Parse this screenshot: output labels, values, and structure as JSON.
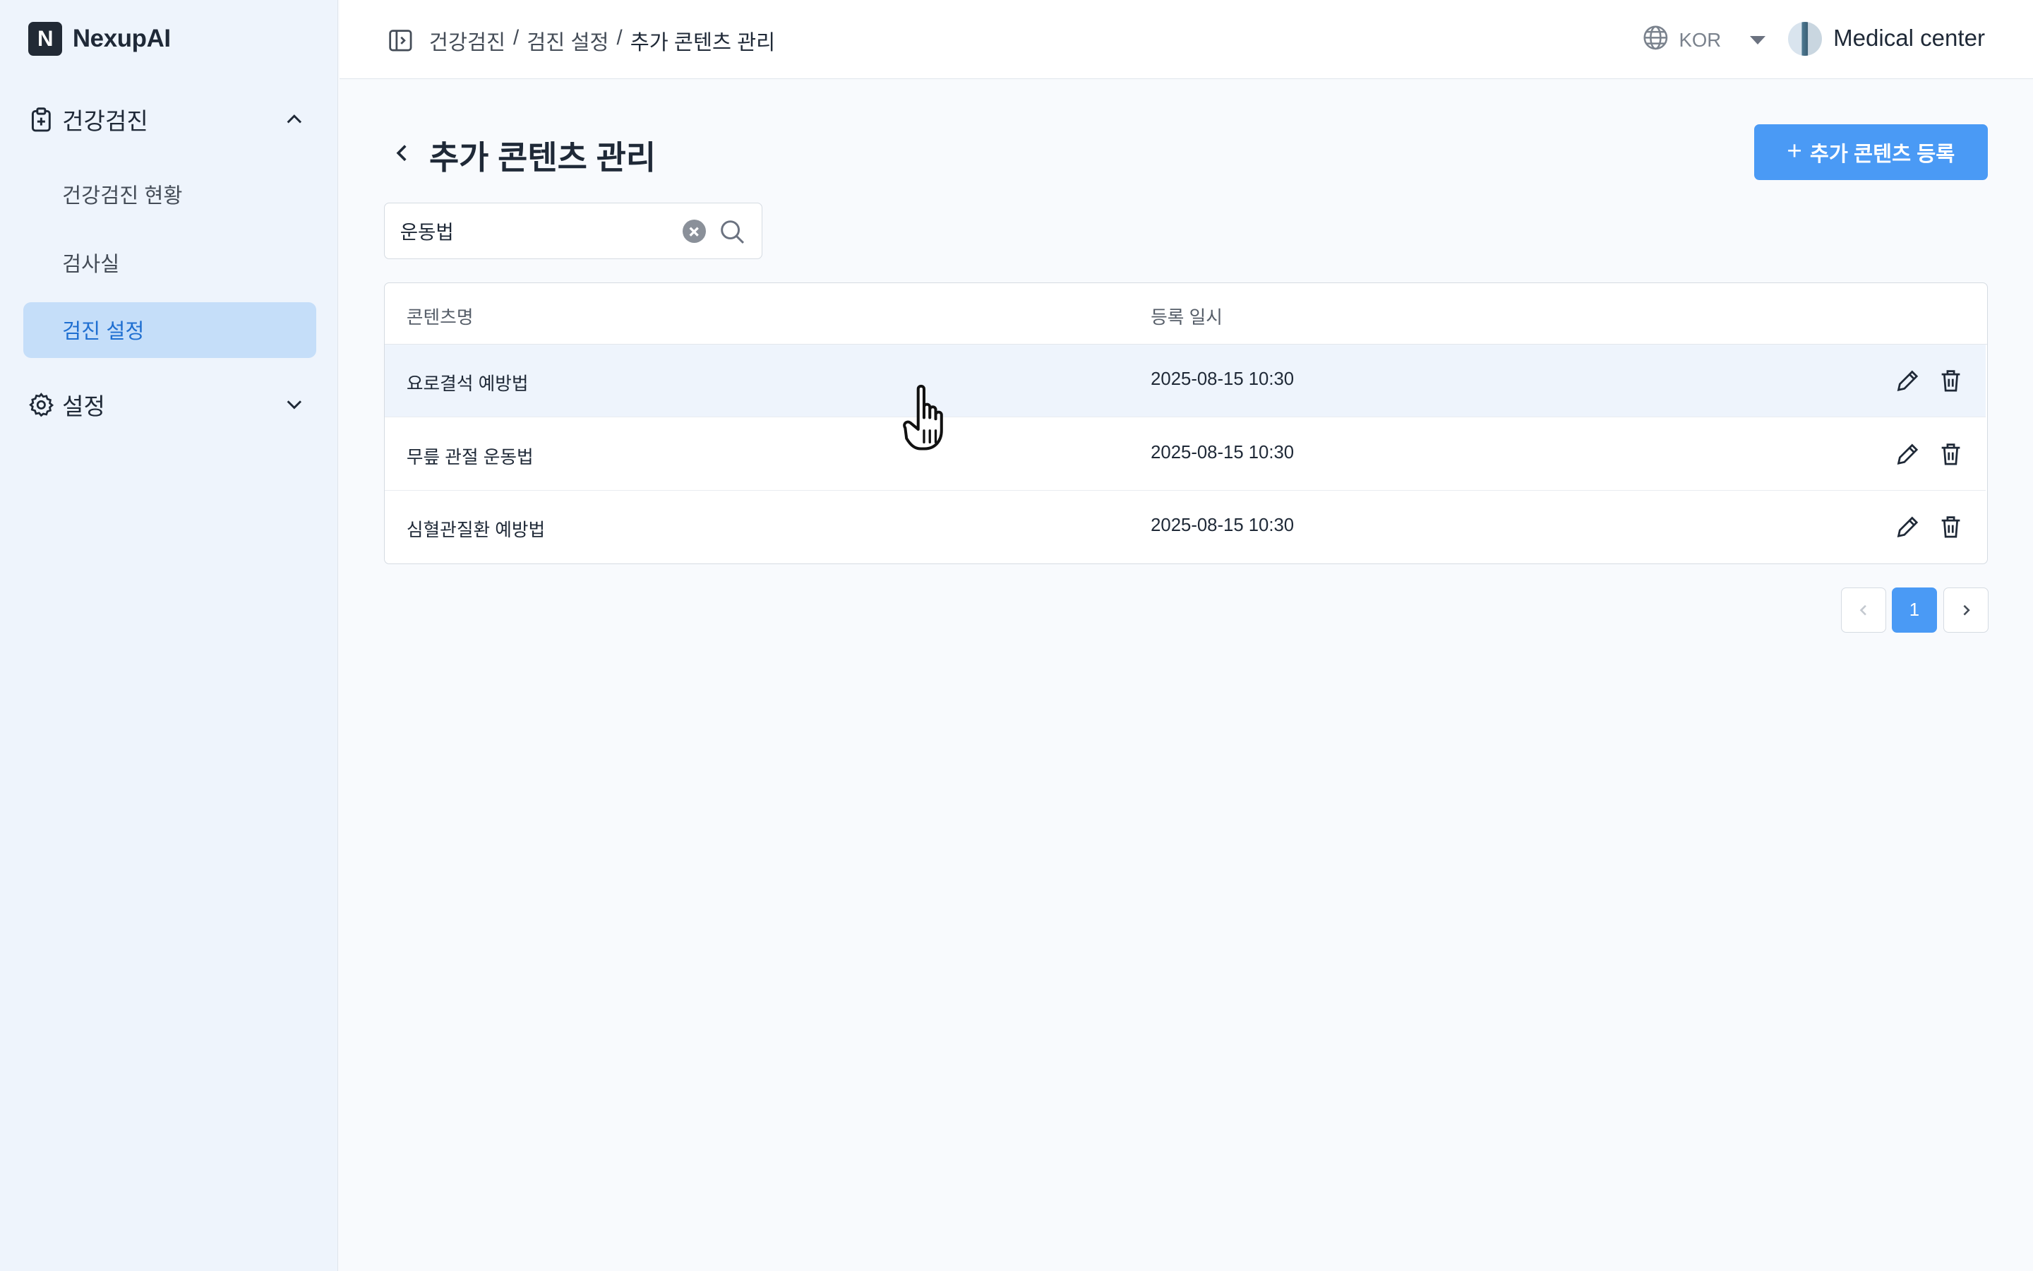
{
  "app": {
    "name": "NexupAI",
    "logo_letter": "N"
  },
  "sidebar": {
    "groups": [
      {
        "label": "건강검진",
        "icon": "clipboard-plus-icon",
        "expanded": true,
        "items": [
          {
            "label": "건강검진 현황",
            "active": false
          },
          {
            "label": "검사실",
            "active": false
          },
          {
            "label": "검진 설정",
            "active": true
          }
        ]
      },
      {
        "label": "설정",
        "icon": "gear-icon",
        "expanded": false,
        "items": []
      }
    ]
  },
  "header": {
    "breadcrumb": [
      "건강검진",
      "검진 설정",
      "추가 콘텐츠 관리"
    ],
    "separator": "/",
    "language": "KOR",
    "organization": "Medical center"
  },
  "page": {
    "title": "추가 콘텐츠 관리",
    "add_button": "추가 콘텐츠 등록",
    "search": {
      "value": "운동법",
      "placeholder": ""
    }
  },
  "table": {
    "columns": [
      "콘텐츠명",
      "등록 일시"
    ],
    "rows": [
      {
        "name": "요로결석 예방법",
        "date": "2025-08-15 10:30",
        "hovered": true
      },
      {
        "name": "무릎 관절 운동법",
        "date": "2025-08-15 10:30",
        "hovered": false
      },
      {
        "name": "심혈관질환 예방법",
        "date": "2025-08-15 10:30",
        "hovered": false
      }
    ]
  },
  "pagination": {
    "current": "1",
    "pages": [
      "1"
    ]
  },
  "colors": {
    "primary": "#4a9af5",
    "sidebar_bg": "#eef4fc",
    "active_item_bg": "#c5def9",
    "active_item_text": "#1f6fd1"
  }
}
